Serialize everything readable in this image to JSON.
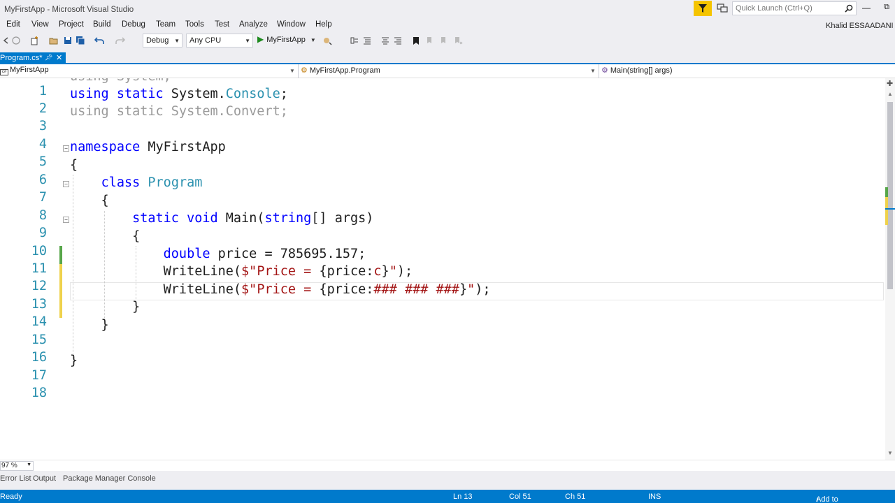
{
  "window": {
    "title": "MyFirstApp - Microsoft Visual Studio",
    "minimize_glyph": "—",
    "restore_glyph": "⧉"
  },
  "quick_launch": {
    "placeholder": "Quick Launch (Ctrl+Q)"
  },
  "menu": [
    "Edit",
    "View",
    "Project",
    "Build",
    "Debug",
    "Team",
    "Tools",
    "Test",
    "Analyze",
    "Window",
    "Help"
  ],
  "user": {
    "name": "Khalid ESSAADANI"
  },
  "toolbar": {
    "config": "Debug",
    "platform": "Any CPU",
    "run_label": "MyFirstApp"
  },
  "tabs": [
    {
      "label": "Program.cs*",
      "active": true
    }
  ],
  "navbar": {
    "project": "MyFirstApp",
    "type": "MyFirstApp.Program",
    "member": "Main(string[] args)"
  },
  "code_lines": [
    "using System;",
    "using static System.Console;",
    "using static System.Convert;",
    "",
    "namespace MyFirstApp",
    "{",
    "    class Program",
    "    {",
    "        static void Main(string[] args)",
    "        {",
    "            double price = 785695.157;",
    "            WriteLine($\"Price = {price:c}\");",
    "            WriteLine($\"Price = {price:### ### ###}\");",
    "        }",
    "    }",
    "",
    "}",
    ""
  ],
  "line_numbers": [
    "1",
    "2",
    "3",
    "4",
    "5",
    "6",
    "7",
    "8",
    "9",
    "10",
    "11",
    "12",
    "13",
    "14",
    "15",
    "16",
    "17",
    "18"
  ],
  "zoom": "97 %",
  "bottom_tabs": [
    "Error List",
    "Output",
    "Package Manager Console"
  ],
  "status": {
    "state": "Ready",
    "line": "Ln 13",
    "col": "Col 51",
    "ch": "Ch 51",
    "mode": "INS",
    "source_control": "Add to Source Control"
  },
  "colors": {
    "accent": "#007acc",
    "keyword": "#0000ff",
    "type": "#2b91af",
    "string": "#a31515",
    "filter_button": "#f5c400"
  }
}
